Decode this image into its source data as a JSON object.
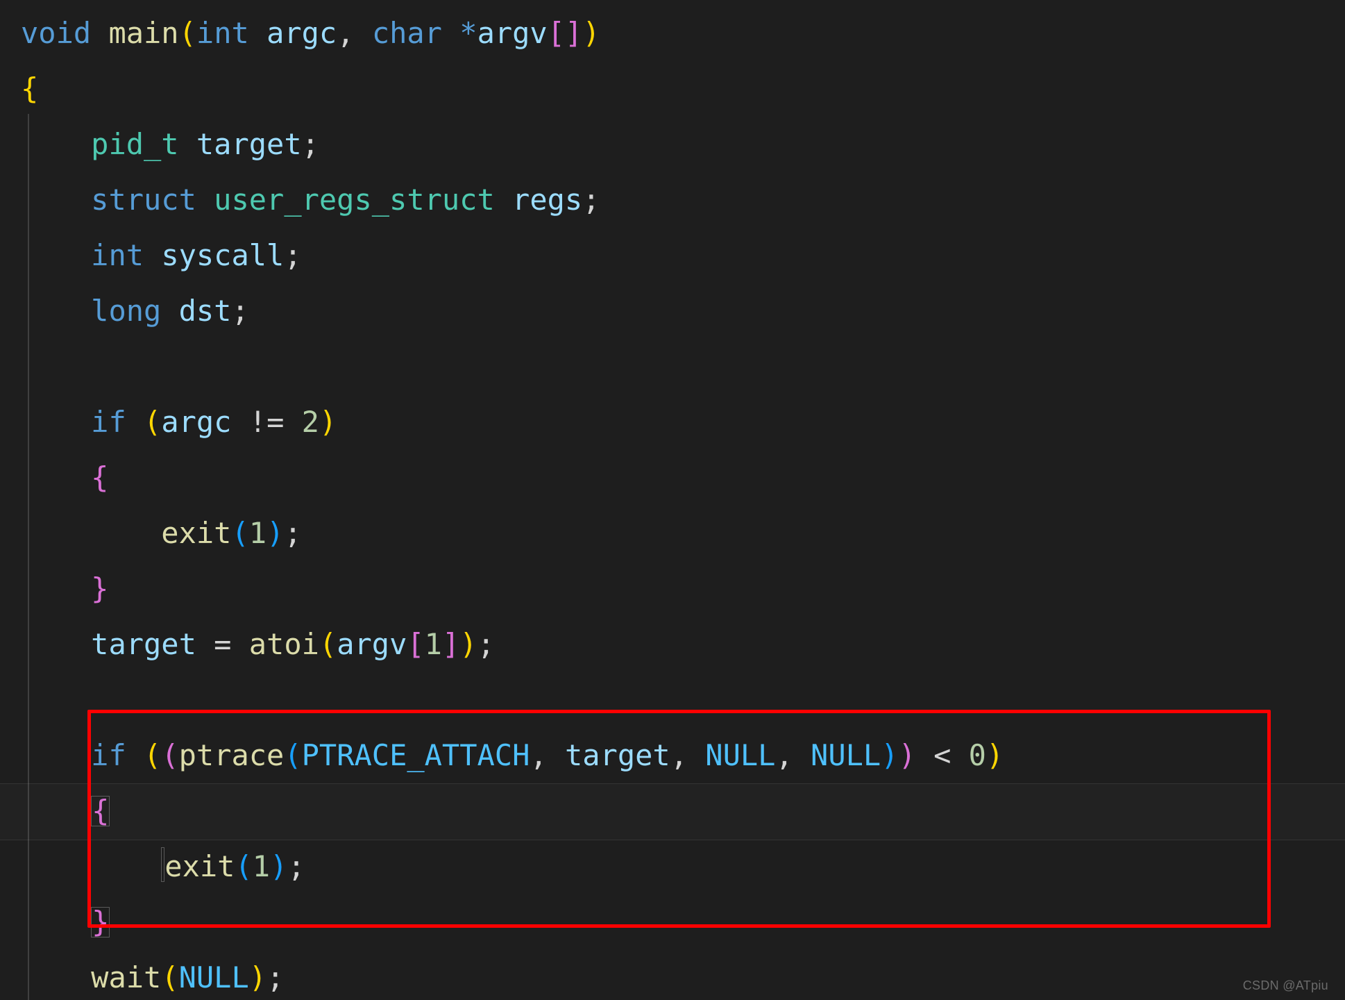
{
  "code": {
    "kw_void": "void",
    "kw_int": "int",
    "kw_char": "char",
    "kw_struct": "struct",
    "kw_long": "long",
    "kw_if": "if",
    "fn_main": "main",
    "fn_exit": "exit",
    "fn_atoi": "atoi",
    "fn_ptrace": "ptrace",
    "fn_wait": "wait",
    "ty_pid_t": "pid_t",
    "ty_user_regs_struct": "user_regs_struct",
    "var_argc": "argc",
    "var_argv": "argv",
    "var_target": "target",
    "var_regs": "regs",
    "var_syscall": "syscall",
    "var_dst": "dst",
    "const_PTRACE_ATTACH": "PTRACE_ATTACH",
    "const_NULL": "NULL",
    "num_1": "1",
    "num_2": "2",
    "num_0": "0",
    "op_star": "*",
    "op_neq": "!=",
    "op_eq": "=",
    "op_lt": "<",
    "p_open": "(",
    "p_close": ")",
    "br_open": "{",
    "br_close": "}",
    "sq_open": "[",
    "sq_close": "]",
    "semi": ";",
    "comma": ","
  },
  "watermark": "CSDN @ATpiu"
}
